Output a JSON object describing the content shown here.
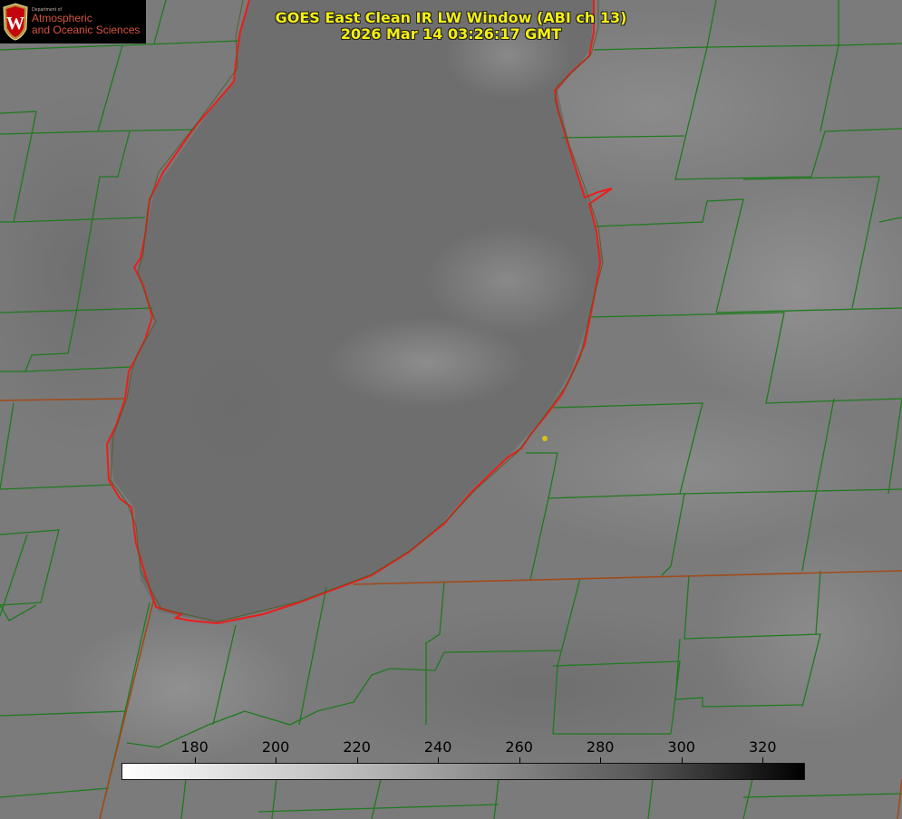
{
  "title": {
    "line1": "GOES East Clean IR LW Window (ABI ch 13)",
    "line2": "2026 Mar 14 03:26:17 GMT"
  },
  "logo": {
    "crest_letter": "W",
    "dept": "Department of",
    "line1": "Atmospheric",
    "line2": "and Oceanic Sciences"
  },
  "colorbar": {
    "min": 162,
    "max": 330,
    "ticks": [
      "180",
      "200",
      "220",
      "240",
      "260",
      "280",
      "300",
      "320"
    ]
  },
  "colors": {
    "county_lines": "#1f7a1f",
    "state_lines": "#a24a1a",
    "shoreline": "#ee1c1c",
    "title_text": "#f4ef12",
    "marker": "#d4c21a",
    "logo_text": "#d9543e"
  },
  "icons": {
    "crest": "uw-crest-icon",
    "station": "station-dot-icon"
  }
}
